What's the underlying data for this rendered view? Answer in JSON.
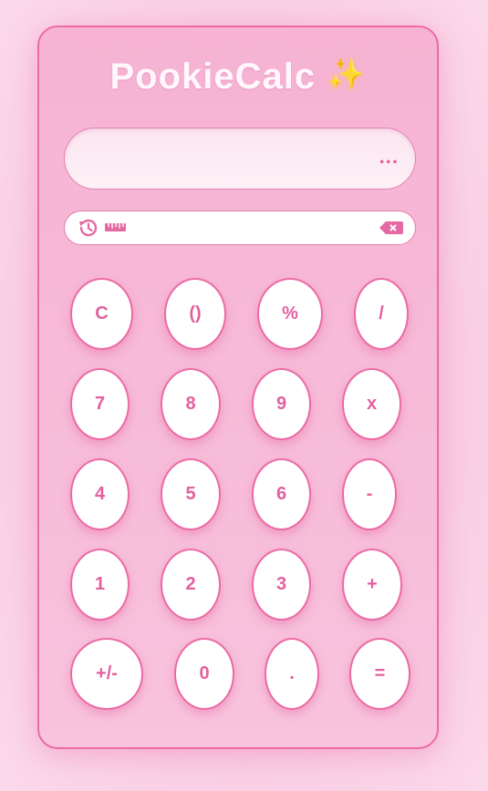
{
  "app": {
    "title": "PookieCalc",
    "title_sparkle": "✨"
  },
  "display": {
    "value": "...",
    "placeholder": ""
  },
  "toolbar": {
    "history_icon": "history-icon",
    "ruler_icon": "ruler-icon",
    "backspace_icon": "backspace-icon"
  },
  "keypad": {
    "rows": [
      [
        {
          "label": "C",
          "name": "clear-button"
        },
        {
          "label": "()",
          "name": "parentheses-button"
        },
        {
          "label": "%",
          "name": "percent-button"
        },
        {
          "label": "/",
          "name": "divide-button"
        }
      ],
      [
        {
          "label": "7",
          "name": "digit-7-button"
        },
        {
          "label": "8",
          "name": "digit-8-button"
        },
        {
          "label": "9",
          "name": "digit-9-button"
        },
        {
          "label": "x",
          "name": "multiply-button"
        }
      ],
      [
        {
          "label": "4",
          "name": "digit-4-button"
        },
        {
          "label": "5",
          "name": "digit-5-button"
        },
        {
          "label": "6",
          "name": "digit-6-button"
        },
        {
          "label": "-",
          "name": "subtract-button"
        }
      ],
      [
        {
          "label": "1",
          "name": "digit-1-button"
        },
        {
          "label": "2",
          "name": "digit-2-button"
        },
        {
          "label": "3",
          "name": "digit-3-button"
        },
        {
          "label": "+",
          "name": "add-button"
        }
      ],
      [
        {
          "label": "+/-",
          "name": "negate-button"
        },
        {
          "label": "0",
          "name": "digit-0-button"
        },
        {
          "label": ".",
          "name": "decimal-button"
        },
        {
          "label": "=",
          "name": "equals-button"
        }
      ]
    ]
  },
  "colors": {
    "accent": "#ec6aa6",
    "key_text": "#e3609f",
    "panel": "#f6b3d3",
    "background": "#f9cbe3"
  }
}
